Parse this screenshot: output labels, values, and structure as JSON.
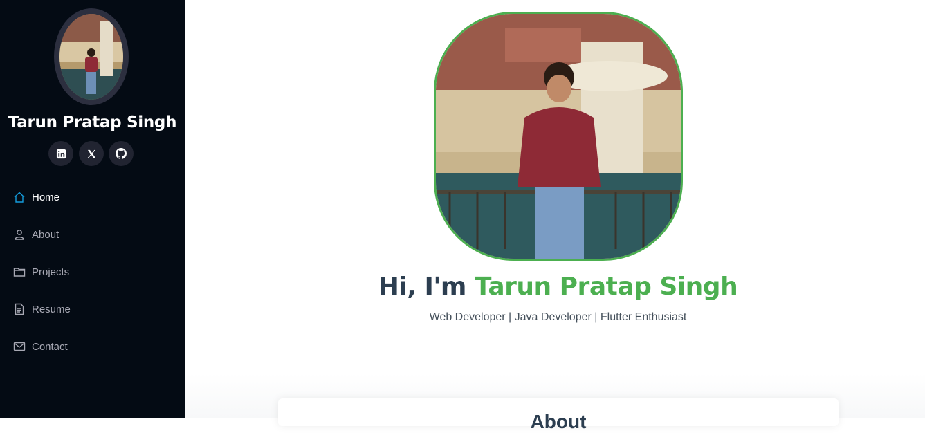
{
  "sidebar": {
    "name": "Tarun Pratap Singh",
    "social": [
      "linkedin-icon",
      "x-twitter-icon",
      "github-icon"
    ],
    "nav": [
      {
        "label": "Home",
        "icon": "home-icon",
        "active": true
      },
      {
        "label": "About",
        "icon": "person-icon",
        "active": false
      },
      {
        "label": "Projects",
        "icon": "folder-icon",
        "active": false
      },
      {
        "label": "Resume",
        "icon": "document-icon",
        "active": false
      },
      {
        "label": "Contact",
        "icon": "envelope-icon",
        "active": false
      }
    ]
  },
  "hero": {
    "greeting": "Hi, I'm",
    "name": "Tarun Pratap Singh",
    "subtitle": "Web Developer | Java Developer | Flutter Enthusiast"
  },
  "section": {
    "title": "About"
  },
  "colors": {
    "sidebar_bg": "#040b14",
    "accent": "#4caf50",
    "nav_active_icon": "#149ddd",
    "heading": "#2c3e50"
  }
}
